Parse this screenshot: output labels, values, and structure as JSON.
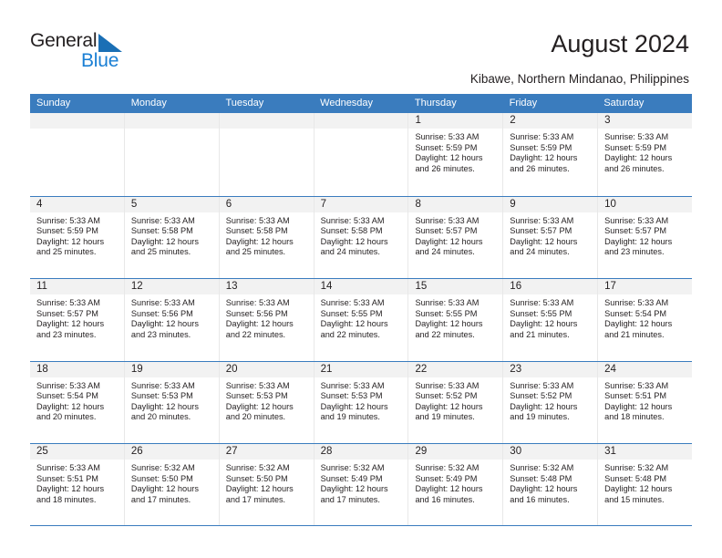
{
  "brand": {
    "name_primary": "General",
    "name_secondary": "Blue",
    "flag_icon": "triangle-flag-icon",
    "accent_color": "#1a7fd4"
  },
  "header": {
    "title": "August 2024",
    "location": "Kibawe, Northern Mindanao, Philippines",
    "header_bar_color": "#3a7cbe"
  },
  "weekdays": [
    "Sunday",
    "Monday",
    "Tuesday",
    "Wednesday",
    "Thursday",
    "Friday",
    "Saturday"
  ],
  "labels": {
    "sunrise_prefix": "Sunrise: ",
    "sunset_prefix": "Sunset: ",
    "daylight_prefix": "Daylight: "
  },
  "weeks": [
    [
      {
        "empty": true
      },
      {
        "empty": true
      },
      {
        "empty": true
      },
      {
        "empty": true
      },
      {
        "day": "1",
        "sunrise": "Sunrise: 5:33 AM",
        "sunset": "Sunset: 5:59 PM",
        "daylight": "Daylight: 12 hours and 26 minutes."
      },
      {
        "day": "2",
        "sunrise": "Sunrise: 5:33 AM",
        "sunset": "Sunset: 5:59 PM",
        "daylight": "Daylight: 12 hours and 26 minutes."
      },
      {
        "day": "3",
        "sunrise": "Sunrise: 5:33 AM",
        "sunset": "Sunset: 5:59 PM",
        "daylight": "Daylight: 12 hours and 26 minutes."
      }
    ],
    [
      {
        "day": "4",
        "sunrise": "Sunrise: 5:33 AM",
        "sunset": "Sunset: 5:59 PM",
        "daylight": "Daylight: 12 hours and 25 minutes."
      },
      {
        "day": "5",
        "sunrise": "Sunrise: 5:33 AM",
        "sunset": "Sunset: 5:58 PM",
        "daylight": "Daylight: 12 hours and 25 minutes."
      },
      {
        "day": "6",
        "sunrise": "Sunrise: 5:33 AM",
        "sunset": "Sunset: 5:58 PM",
        "daylight": "Daylight: 12 hours and 25 minutes."
      },
      {
        "day": "7",
        "sunrise": "Sunrise: 5:33 AM",
        "sunset": "Sunset: 5:58 PM",
        "daylight": "Daylight: 12 hours and 24 minutes."
      },
      {
        "day": "8",
        "sunrise": "Sunrise: 5:33 AM",
        "sunset": "Sunset: 5:57 PM",
        "daylight": "Daylight: 12 hours and 24 minutes."
      },
      {
        "day": "9",
        "sunrise": "Sunrise: 5:33 AM",
        "sunset": "Sunset: 5:57 PM",
        "daylight": "Daylight: 12 hours and 24 minutes."
      },
      {
        "day": "10",
        "sunrise": "Sunrise: 5:33 AM",
        "sunset": "Sunset: 5:57 PM",
        "daylight": "Daylight: 12 hours and 23 minutes."
      }
    ],
    [
      {
        "day": "11",
        "sunrise": "Sunrise: 5:33 AM",
        "sunset": "Sunset: 5:57 PM",
        "daylight": "Daylight: 12 hours and 23 minutes."
      },
      {
        "day": "12",
        "sunrise": "Sunrise: 5:33 AM",
        "sunset": "Sunset: 5:56 PM",
        "daylight": "Daylight: 12 hours and 23 minutes."
      },
      {
        "day": "13",
        "sunrise": "Sunrise: 5:33 AM",
        "sunset": "Sunset: 5:56 PM",
        "daylight": "Daylight: 12 hours and 22 minutes."
      },
      {
        "day": "14",
        "sunrise": "Sunrise: 5:33 AM",
        "sunset": "Sunset: 5:55 PM",
        "daylight": "Daylight: 12 hours and 22 minutes."
      },
      {
        "day": "15",
        "sunrise": "Sunrise: 5:33 AM",
        "sunset": "Sunset: 5:55 PM",
        "daylight": "Daylight: 12 hours and 22 minutes."
      },
      {
        "day": "16",
        "sunrise": "Sunrise: 5:33 AM",
        "sunset": "Sunset: 5:55 PM",
        "daylight": "Daylight: 12 hours and 21 minutes."
      },
      {
        "day": "17",
        "sunrise": "Sunrise: 5:33 AM",
        "sunset": "Sunset: 5:54 PM",
        "daylight": "Daylight: 12 hours and 21 minutes."
      }
    ],
    [
      {
        "day": "18",
        "sunrise": "Sunrise: 5:33 AM",
        "sunset": "Sunset: 5:54 PM",
        "daylight": "Daylight: 12 hours and 20 minutes."
      },
      {
        "day": "19",
        "sunrise": "Sunrise: 5:33 AM",
        "sunset": "Sunset: 5:53 PM",
        "daylight": "Daylight: 12 hours and 20 minutes."
      },
      {
        "day": "20",
        "sunrise": "Sunrise: 5:33 AM",
        "sunset": "Sunset: 5:53 PM",
        "daylight": "Daylight: 12 hours and 20 minutes."
      },
      {
        "day": "21",
        "sunrise": "Sunrise: 5:33 AM",
        "sunset": "Sunset: 5:53 PM",
        "daylight": "Daylight: 12 hours and 19 minutes."
      },
      {
        "day": "22",
        "sunrise": "Sunrise: 5:33 AM",
        "sunset": "Sunset: 5:52 PM",
        "daylight": "Daylight: 12 hours and 19 minutes."
      },
      {
        "day": "23",
        "sunrise": "Sunrise: 5:33 AM",
        "sunset": "Sunset: 5:52 PM",
        "daylight": "Daylight: 12 hours and 19 minutes."
      },
      {
        "day": "24",
        "sunrise": "Sunrise: 5:33 AM",
        "sunset": "Sunset: 5:51 PM",
        "daylight": "Daylight: 12 hours and 18 minutes."
      }
    ],
    [
      {
        "day": "25",
        "sunrise": "Sunrise: 5:33 AM",
        "sunset": "Sunset: 5:51 PM",
        "daylight": "Daylight: 12 hours and 18 minutes."
      },
      {
        "day": "26",
        "sunrise": "Sunrise: 5:32 AM",
        "sunset": "Sunset: 5:50 PM",
        "daylight": "Daylight: 12 hours and 17 minutes."
      },
      {
        "day": "27",
        "sunrise": "Sunrise: 5:32 AM",
        "sunset": "Sunset: 5:50 PM",
        "daylight": "Daylight: 12 hours and 17 minutes."
      },
      {
        "day": "28",
        "sunrise": "Sunrise: 5:32 AM",
        "sunset": "Sunset: 5:49 PM",
        "daylight": "Daylight: 12 hours and 17 minutes."
      },
      {
        "day": "29",
        "sunrise": "Sunrise: 5:32 AM",
        "sunset": "Sunset: 5:49 PM",
        "daylight": "Daylight: 12 hours and 16 minutes."
      },
      {
        "day": "30",
        "sunrise": "Sunrise: 5:32 AM",
        "sunset": "Sunset: 5:48 PM",
        "daylight": "Daylight: 12 hours and 16 minutes."
      },
      {
        "day": "31",
        "sunrise": "Sunrise: 5:32 AM",
        "sunset": "Sunset: 5:48 PM",
        "daylight": "Daylight: 12 hours and 15 minutes."
      }
    ]
  ]
}
